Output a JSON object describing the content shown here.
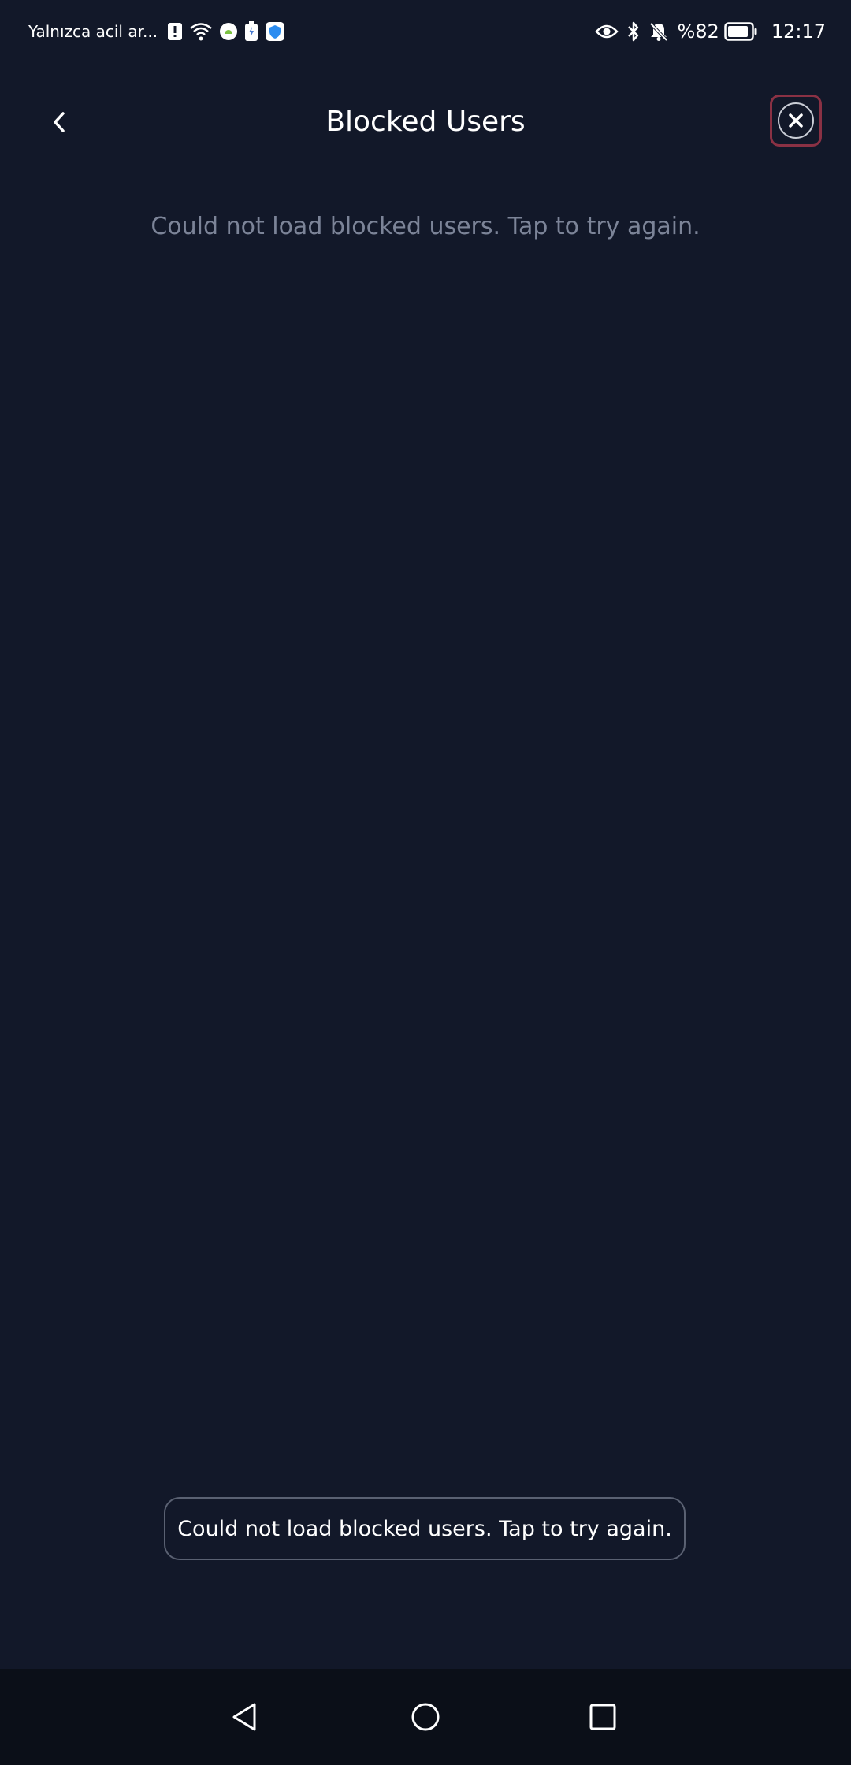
{
  "status_bar": {
    "carrier_text": "Yalnızca acil ar...",
    "battery_percent": "%82",
    "time": "12:17",
    "icons_left": [
      "alert-icon",
      "wifi-icon",
      "android-icon",
      "battery-saver-icon",
      "shield-app-icon"
    ],
    "icons_right": [
      "eye-icon",
      "bluetooth-icon",
      "bell-off-icon",
      "battery-icon"
    ]
  },
  "header": {
    "title": "Blocked Users"
  },
  "main": {
    "error_message": "Could not load blocked users. Tap to try again."
  },
  "toast": {
    "message": "Could not load blocked users. Tap to try again."
  },
  "navigation": {
    "buttons": [
      "back-triangle-icon",
      "home-circle-icon",
      "recents-square-icon"
    ]
  },
  "colors": {
    "background": "#121829",
    "secondary_text": "#7c8498",
    "close_highlight": "#8a3144",
    "nav_bar": "#0b0f18"
  }
}
